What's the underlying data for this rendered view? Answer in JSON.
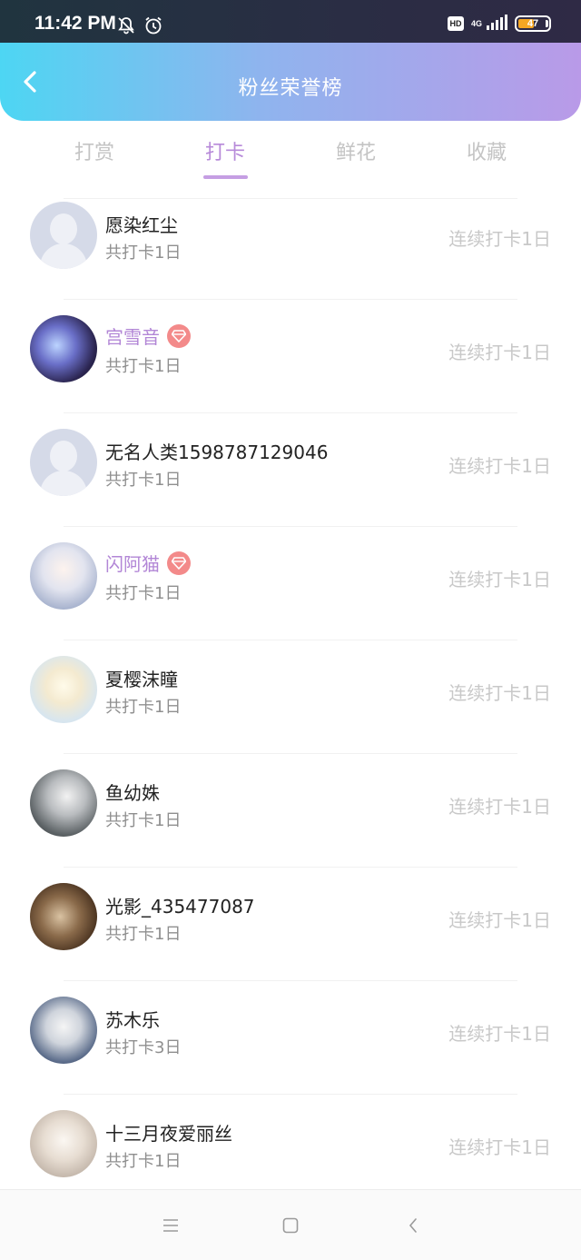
{
  "status_bar": {
    "time": "11:42 PM",
    "hd": "HD",
    "network": "4G",
    "battery": "47"
  },
  "header": {
    "title": "粉丝荣誉榜"
  },
  "tabs": [
    {
      "label": "打赏",
      "active": false
    },
    {
      "label": "打卡",
      "active": true
    },
    {
      "label": "鲜花",
      "active": false
    },
    {
      "label": "收藏",
      "active": false
    }
  ],
  "rows": [
    {
      "name": "愿染红尘",
      "sub": "共打卡1日",
      "streak": "连续打卡1日",
      "vip": false,
      "avatar": "default"
    },
    {
      "name": "宫雪音",
      "sub": "共打卡1日",
      "streak": "连续打卡1日",
      "vip": true,
      "avatar": "photo"
    },
    {
      "name": "无名人类1598787129046",
      "sub": "共打卡1日",
      "streak": "连续打卡1日",
      "vip": false,
      "avatar": "default"
    },
    {
      "name": "闪阿猫",
      "sub": "共打卡1日",
      "streak": "连续打卡1日",
      "vip": true,
      "avatar": "photo"
    },
    {
      "name": "夏樱沫瞳",
      "sub": "共打卡1日",
      "streak": "连续打卡1日",
      "vip": false,
      "avatar": "photo"
    },
    {
      "name": "鱼幼姝",
      "sub": "共打卡1日",
      "streak": "连续打卡1日",
      "vip": false,
      "avatar": "photo"
    },
    {
      "name": "光影_435477087",
      "sub": "共打卡1日",
      "streak": "连续打卡1日",
      "vip": false,
      "avatar": "photo"
    },
    {
      "name": "苏木乐",
      "sub": "共打卡3日",
      "streak": "连续打卡1日",
      "vip": false,
      "avatar": "photo"
    },
    {
      "name": "十三月夜爱丽丝",
      "sub": "共打卡1日",
      "streak": "连续打卡1日",
      "vip": false,
      "avatar": "photo"
    }
  ],
  "colors": {
    "accent": "#b78ad9",
    "vip_badge": "#f38a8a",
    "header_start": "#4dd6f3",
    "header_end": "#b99ae8"
  }
}
